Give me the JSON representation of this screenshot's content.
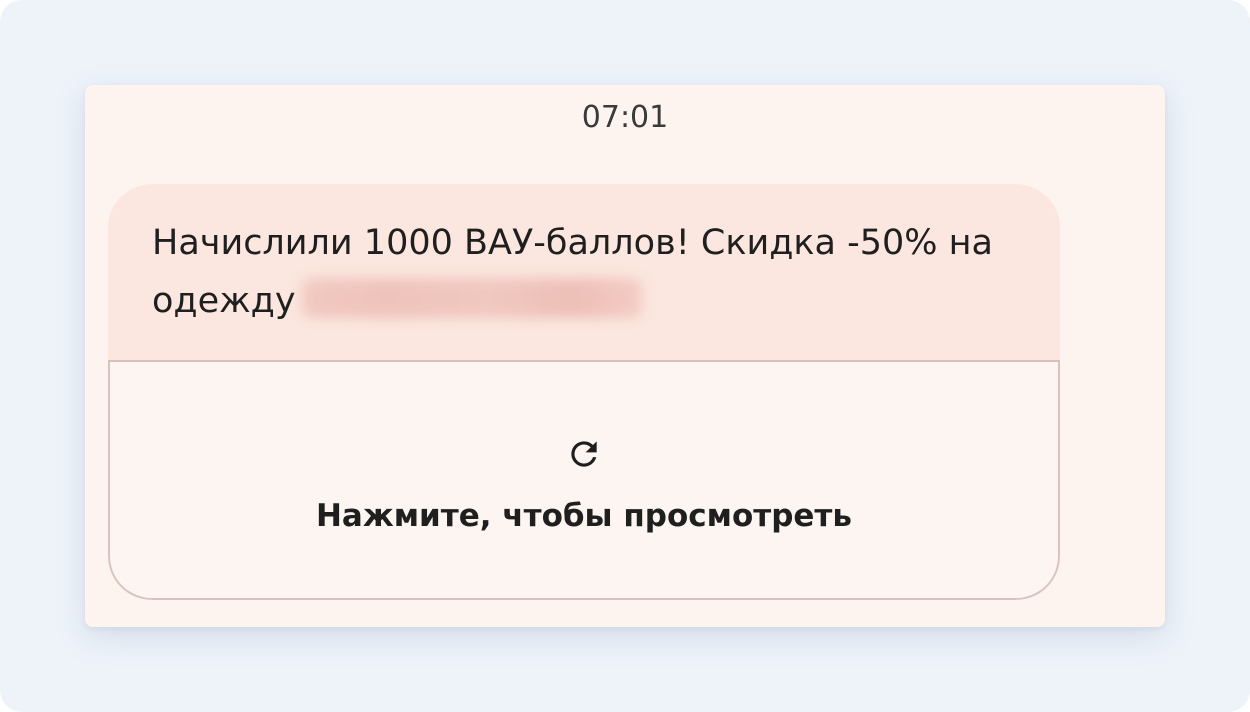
{
  "message": {
    "time": "07:01",
    "text": "Начислили 1000 ВАУ-баллов! Скидка -50% на одежду",
    "link_blurred": true,
    "action_label": "Нажмите, чтобы просмотреть",
    "action_icon": "refresh-icon"
  },
  "colors": {
    "background": "#eef3fa",
    "card": "#fdf4ef",
    "bubble_top": "#fbe7df",
    "bubble_bottom": "#fdf5f1",
    "text": "#1f1f1f"
  }
}
